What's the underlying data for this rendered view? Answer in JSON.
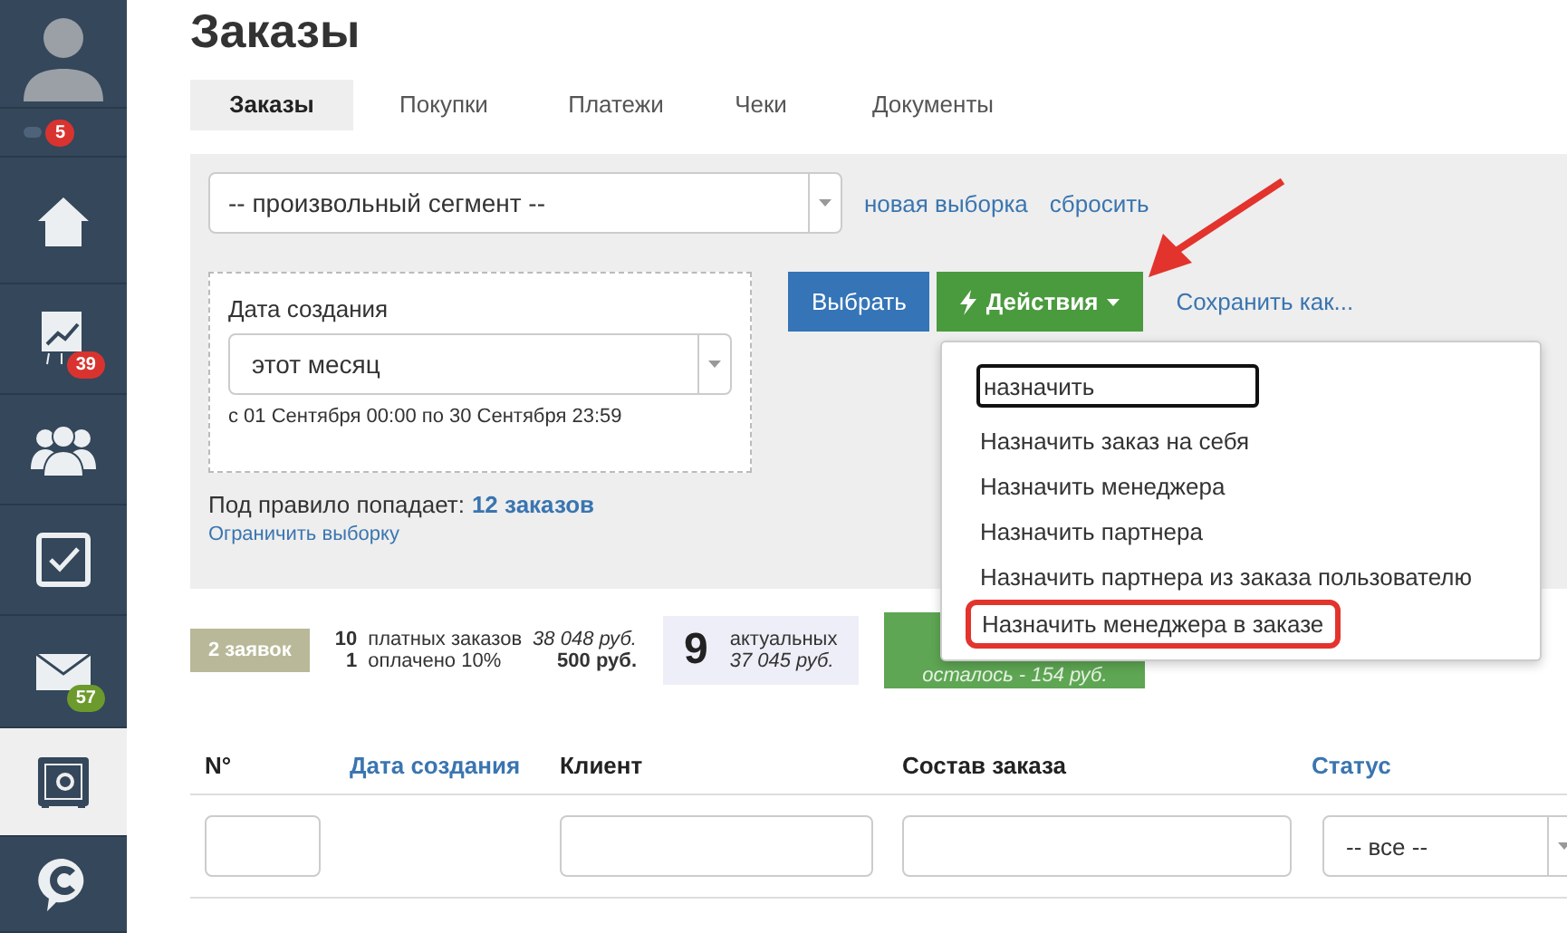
{
  "sidebar": {
    "items": [
      {
        "kind": "avatar",
        "selected": false
      },
      {
        "kind": "notify",
        "badge": "5",
        "color": "#d9332f",
        "selected": false
      },
      {
        "kind": "home",
        "selected": false
      },
      {
        "kind": "chart",
        "badge": "39",
        "color": "#d9332f",
        "selected": false
      },
      {
        "kind": "people",
        "selected": false
      },
      {
        "kind": "check",
        "selected": false
      },
      {
        "kind": "mail",
        "badge": "57",
        "color": "#6c9a2c",
        "selected": false
      },
      {
        "kind": "safe",
        "selected": true
      },
      {
        "kind": "chat",
        "selected": false
      }
    ]
  },
  "title": "Заказы",
  "tabs": [
    {
      "label": "Заказы",
      "selected": true
    },
    {
      "label": "Покупки",
      "selected": false
    },
    {
      "label": "Платежи",
      "selected": false
    },
    {
      "label": "Чеки",
      "selected": false
    },
    {
      "label": "Документы",
      "selected": false
    }
  ],
  "filter": {
    "segment": "-- произвольный сегмент --",
    "links": [
      "новая выборка",
      "сбросить"
    ],
    "date_label": "Дата создания",
    "date_value": "этот месяц",
    "date_range": "с 01 Сентября 00:00 по 30 Сентября 23:59",
    "rule_text": "Под правило попадает:",
    "rule_count": "12 заказов",
    "limit_link": "Ограничить выборку",
    "select_button": "Выбрать",
    "actions_button": "Действия",
    "save_link": "Сохранить как..."
  },
  "actions_menu": {
    "search_value": "назначить",
    "items": [
      {
        "label": "Назначить заказ на себя",
        "highlighted": false
      },
      {
        "label": "Назначить менеджера",
        "highlighted": false
      },
      {
        "label": "Назначить партнера",
        "highlighted": false
      },
      {
        "label": "Назначить партнера из заказа пользователю",
        "highlighted": false
      },
      {
        "label": "Назначить менеджера в заказе",
        "highlighted": true
      }
    ]
  },
  "stats": {
    "requests": "2 заявок",
    "rows": [
      {
        "count": "10",
        "label": "платных заказов",
        "sum": "38 048 руб.",
        "sum_italic": true
      },
      {
        "count": "1",
        "label": "оплачено 10%",
        "sum": "500 руб.",
        "sum_italic": false
      }
    ],
    "actual_count": "9",
    "actual_label": "актуальных",
    "actual_sum": "37 045 руб.",
    "remaining": "осталось - 154 руб."
  },
  "table": {
    "columns": [
      {
        "label": "N°",
        "link": false
      },
      {
        "label": "Дата создания",
        "link": true
      },
      {
        "label": "Клиент",
        "link": false
      },
      {
        "label": "Состав заказа",
        "link": false
      },
      {
        "label": "Статус",
        "link": true
      }
    ],
    "status_filter": "-- все --"
  }
}
